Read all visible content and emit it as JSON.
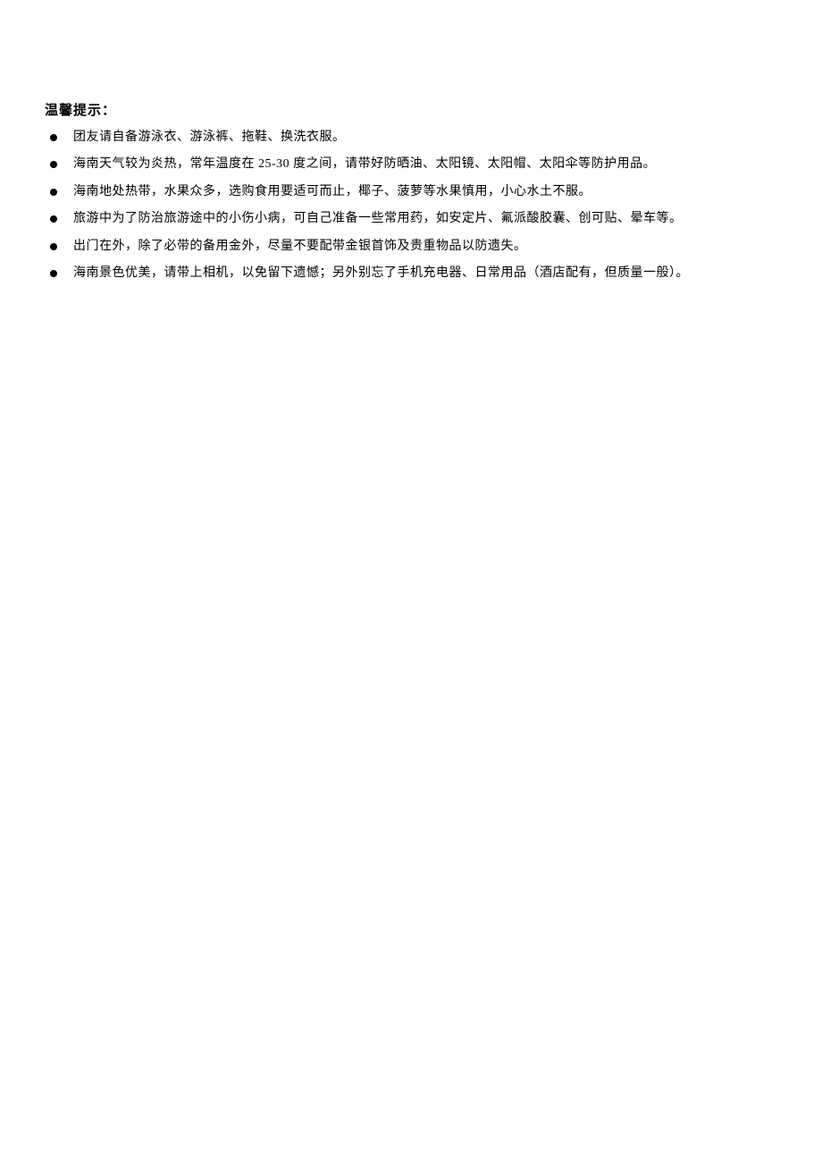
{
  "title": "温馨提示：",
  "items": [
    "团友请自备游泳衣、游泳裤、拖鞋、换洗衣服。",
    "海南天气较为炎热，常年温度在 25-30 度之间，请带好防晒油、太阳镜、太阳帽、太阳伞等防护用品。",
    "海南地处热带，水果众多，选购食用要适可而止，椰子、菠萝等水果慎用，小心水土不服。",
    "旅游中为了防治旅游途中的小伤小病，可自己准备一些常用药，如安定片、氟派酸胶囊、创可贴、晕车等。",
    "出门在外，除了必带的备用金外，尽量不要配带金银首饰及贵重物品以防遗失。",
    "海南景色优美，请带上相机，以免留下遗憾；另外别忘了手机充电器、日常用品（酒店配有，但质量一般）。"
  ]
}
